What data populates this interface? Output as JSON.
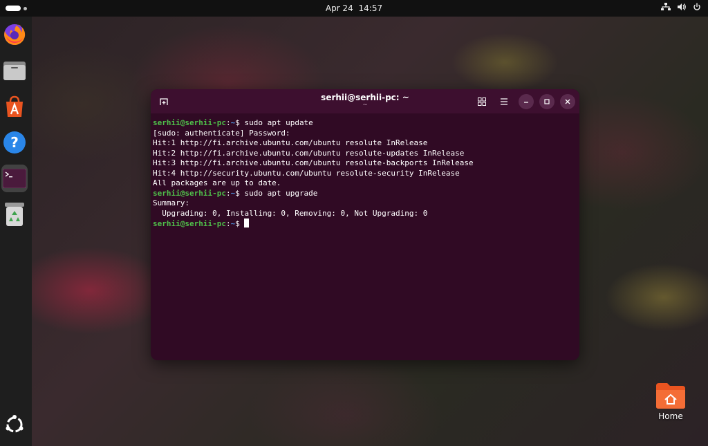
{
  "topbar": {
    "date": "Apr 24",
    "time": "14:57",
    "tray_icons": [
      "network-icon",
      "volume-icon",
      "power-icon"
    ]
  },
  "dock": {
    "items": [
      {
        "name": "firefox",
        "icon": "firefox-icon",
        "active": false
      },
      {
        "name": "files",
        "icon": "files-icon",
        "active": false
      },
      {
        "name": "app-center",
        "icon": "app-center-icon",
        "active": false
      },
      {
        "name": "help",
        "icon": "help-icon",
        "active": false
      },
      {
        "name": "terminal",
        "icon": "terminal-icon",
        "active": true
      },
      {
        "name": "trash",
        "icon": "trash-icon",
        "active": false
      }
    ],
    "apps_button": "show-apps-icon"
  },
  "terminal": {
    "title": "serhii@serhii-pc: ~",
    "subtitle": "~",
    "prompt_user": "serhii@serhii-pc",
    "prompt_path": "~",
    "lines": [
      {
        "type": "cmd",
        "prompt_user": "serhii@serhii-pc",
        "prompt_sep": ":",
        "prompt_path": "~",
        "prompt_end": "$ ",
        "text": "sudo apt update"
      },
      {
        "type": "out",
        "text": "[sudo: authenticate] Password:"
      },
      {
        "type": "out",
        "text": "Hit:1 http://fi.archive.ubuntu.com/ubuntu resolute InRelease"
      },
      {
        "type": "out",
        "text": "Hit:2 http://fi.archive.ubuntu.com/ubuntu resolute-updates InRelease"
      },
      {
        "type": "out",
        "text": "Hit:3 http://fi.archive.ubuntu.com/ubuntu resolute-backports InRelease"
      },
      {
        "type": "out",
        "text": "Hit:4 http://security.ubuntu.com/ubuntu resolute-security InRelease"
      },
      {
        "type": "out",
        "text": "All packages are up to date."
      },
      {
        "type": "cmd",
        "prompt_user": "serhii@serhii-pc",
        "prompt_sep": ":",
        "prompt_path": "~",
        "prompt_end": "$ ",
        "text": "sudo apt upgrade"
      },
      {
        "type": "out",
        "text": "Summary:"
      },
      {
        "type": "out",
        "text": "  Upgrading: 0, Installing: 0, Removing: 0, Not Upgrading: 0"
      },
      {
        "type": "cmd",
        "prompt_user": "serhii@serhii-pc",
        "prompt_sep": ":",
        "prompt_path": "~",
        "prompt_end": "$ ",
        "text": ""
      }
    ]
  },
  "desktop": {
    "home_label": "Home"
  },
  "colors": {
    "terminal_bg": "#300a24",
    "prompt_green": "#4fc04a",
    "path_blue": "#4f8fdc",
    "ubuntu_orange": "#e95420"
  }
}
